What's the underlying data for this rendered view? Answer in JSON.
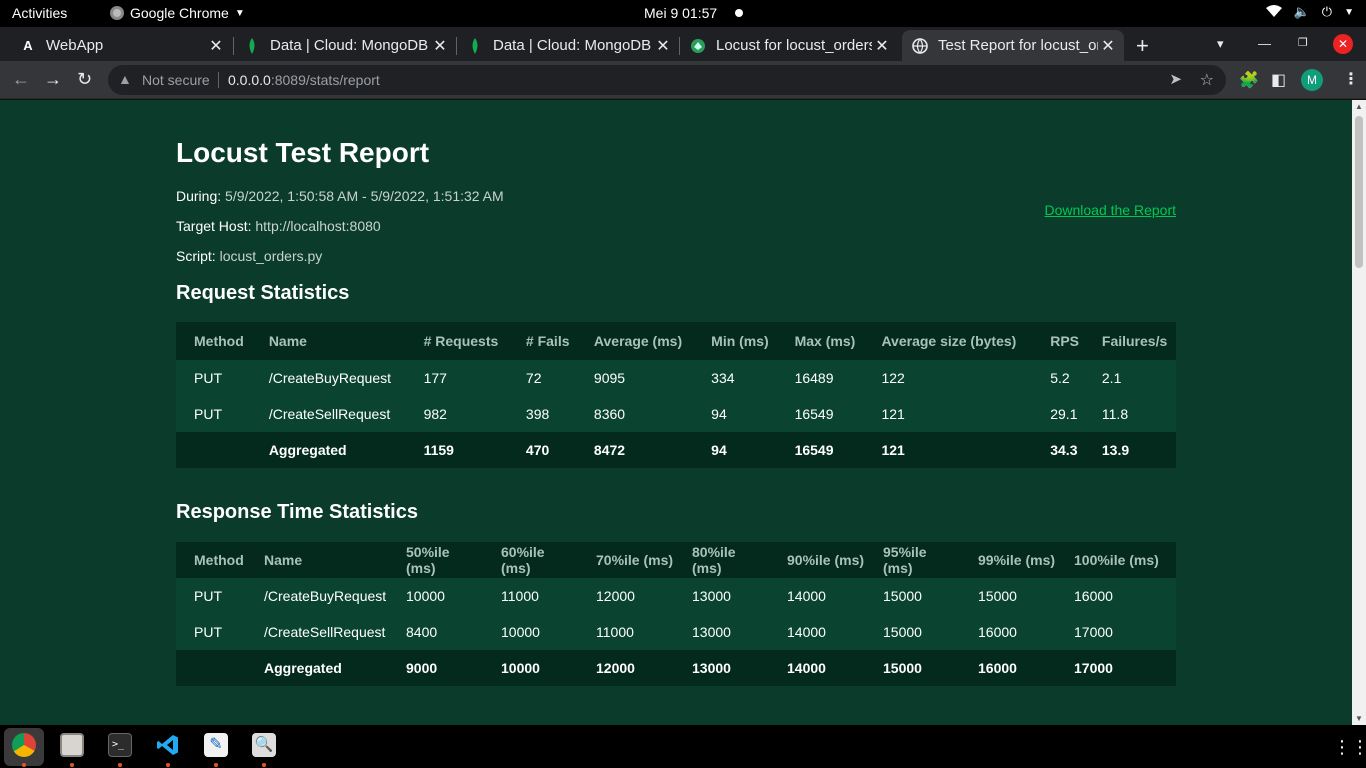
{
  "topbar": {
    "activities": "Activities",
    "app_name": "Google Chrome",
    "clock": "Mei 9  01:57"
  },
  "tabs": [
    {
      "title": "WebApp",
      "favicon": "A"
    },
    {
      "title": "Data | Cloud: MongoDB",
      "favicon": "mongodb-leaf"
    },
    {
      "title": "Data | Cloud: MongoDB",
      "favicon": "mongodb-leaf"
    },
    {
      "title": "Locust for locust_orders",
      "favicon": "locust"
    },
    {
      "title": "Test Report for locust_orders",
      "favicon": "globe"
    }
  ],
  "toolbar": {
    "security_label": "Not secure",
    "url_host": "0.0.0.0",
    "url_path": ":8089/stats/report",
    "profile_initial": "M"
  },
  "report": {
    "title": "Locust Test Report",
    "during_label": "During:",
    "during_value": "5/9/2022, 1:50:58 AM - 5/9/2022, 1:51:32 AM",
    "target_label": "Target Host:",
    "target_value": "http://localhost:8080",
    "script_label": "Script:",
    "script_value": "locust_orders.py",
    "download_link": "Download the Report"
  },
  "request_stats": {
    "heading": "Request Statistics",
    "columns": [
      "Method",
      "Name",
      "# Requests",
      "# Fails",
      "Average (ms)",
      "Min (ms)",
      "Max (ms)",
      "Average size (bytes)",
      "RPS",
      "Failures/s"
    ],
    "rows": [
      [
        "PUT",
        "/CreateBuyRequest",
        "177",
        "72",
        "9095",
        "334",
        "16489",
        "122",
        "5.2",
        "2.1"
      ],
      [
        "PUT",
        "/CreateSellRequest",
        "982",
        "398",
        "8360",
        "94",
        "16549",
        "121",
        "29.1",
        "11.8"
      ],
      [
        "",
        "Aggregated",
        "1159",
        "470",
        "8472",
        "94",
        "16549",
        "121",
        "34.3",
        "13.9"
      ]
    ]
  },
  "response_stats": {
    "heading": "Response Time Statistics",
    "columns": [
      "Method",
      "Name",
      "50%ile (ms)",
      "60%ile (ms)",
      "70%ile (ms)",
      "80%ile (ms)",
      "90%ile (ms)",
      "95%ile (ms)",
      "99%ile (ms)",
      "100%ile (ms)"
    ],
    "rows": [
      [
        "PUT",
        "/CreateBuyRequest",
        "10000",
        "11000",
        "12000",
        "13000",
        "14000",
        "15000",
        "15000",
        "16000"
      ],
      [
        "PUT",
        "/CreateSellRequest",
        "8400",
        "10000",
        "11000",
        "13000",
        "14000",
        "15000",
        "16000",
        "17000"
      ],
      [
        "",
        "Aggregated",
        "9000",
        "10000",
        "12000",
        "13000",
        "14000",
        "15000",
        "16000",
        "17000"
      ]
    ]
  },
  "colors": {
    "page_bg": "#0b3b2b",
    "header_row": "#032a1d",
    "body_row": "#0a4431",
    "link": "#00c853"
  }
}
